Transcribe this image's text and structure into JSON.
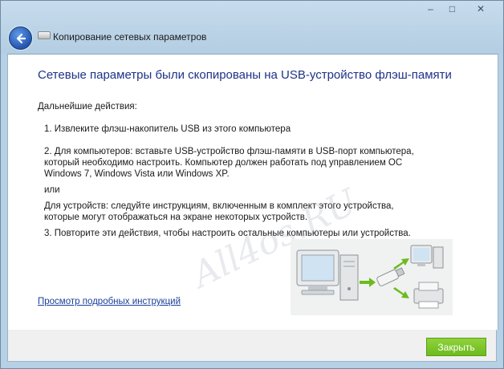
{
  "window": {
    "title": "Копирование сетевых параметров",
    "caption": {
      "minimize_glyph": "–",
      "maximize_glyph": "□",
      "close_glyph": "✕"
    }
  },
  "content": {
    "heading": "Сетевые параметры были скопированы на USB-устройство флэш-памяти",
    "next_steps_label": "Дальнейшие действия:",
    "step1": "1. Извлеките флэш-накопитель USB из этого компьютера",
    "step2_line1": "2. Для компьютеров: вставьте USB-устройство флэш-памяти в USB-порт компьютера,",
    "step2_line2": "который необходимо настроить. Компьютер должен работать под управлением ОС",
    "step2_line3": "Windows 7, Windows Vista или Windows XP.",
    "or_label": "или",
    "devices_line1": "Для устройств: следуйте инструкциям, включенным в комплект этого устройства,",
    "devices_line2": "которые могут отображаться на экране некоторых устройств.",
    "step3": "3. Повторите эти действия, чтобы настроить остальные компьютеры или устройства.",
    "details_link": "Просмотр подробных инструкций",
    "watermark": "All4os.RU"
  },
  "footer": {
    "close_label": "Закрыть"
  },
  "colors": {
    "frame": "#b6d1e6",
    "heading": "#1e3287",
    "link": "#1b3f9b",
    "accent_green": "#7cc42a"
  },
  "icons": [
    "back-arrow-icon",
    "wizard-icon",
    "usb-transfer-illustration"
  ]
}
